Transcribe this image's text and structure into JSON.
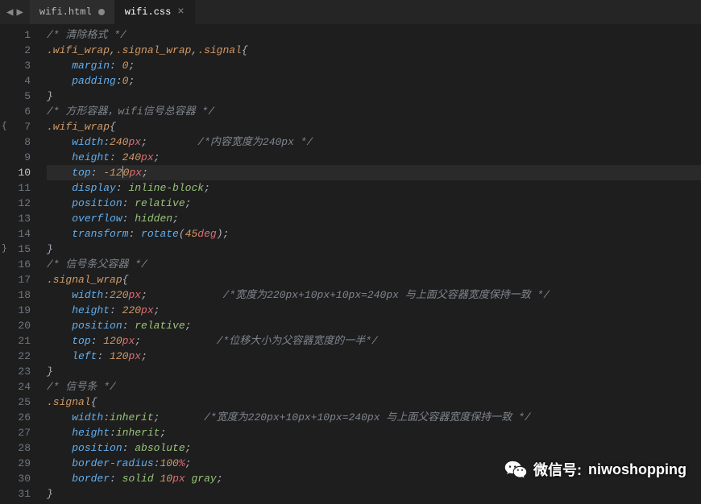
{
  "tabs": [
    {
      "label": "wifi.html",
      "modified": true,
      "active": false
    },
    {
      "label": "wifi.css",
      "modified": false,
      "active": true
    }
  ],
  "active_line": 10,
  "fold_open_line": 7,
  "fold_close_line": 15,
  "code_lines": [
    {
      "n": 1,
      "tokens": [
        {
          "t": "/* 清除格式 */",
          "c": "c-comment"
        }
      ]
    },
    {
      "n": 2,
      "tokens": [
        {
          "t": ".wifi_wrap",
          "c": "c-sel"
        },
        {
          "t": ",",
          "c": "c-punc"
        },
        {
          "t": ".signal_wrap",
          "c": "c-sel"
        },
        {
          "t": ",",
          "c": "c-punc"
        },
        {
          "t": ".signal",
          "c": "c-sel"
        },
        {
          "t": "{",
          "c": "c-brace"
        }
      ]
    },
    {
      "n": 3,
      "indent": 1,
      "tokens": [
        {
          "t": "margin",
          "c": "c-prop"
        },
        {
          "t": ": ",
          "c": "c-punc"
        },
        {
          "t": "0",
          "c": "c-num"
        },
        {
          "t": ";",
          "c": "c-punc"
        }
      ]
    },
    {
      "n": 4,
      "indent": 1,
      "tokens": [
        {
          "t": "padding",
          "c": "c-prop"
        },
        {
          "t": ":",
          "c": "c-punc"
        },
        {
          "t": "0",
          "c": "c-num"
        },
        {
          "t": ";",
          "c": "c-punc"
        }
      ]
    },
    {
      "n": 5,
      "tokens": [
        {
          "t": "}",
          "c": "c-brace"
        }
      ]
    },
    {
      "n": 6,
      "tokens": [
        {
          "t": "/* 方形容器，wifi信号总容器 */",
          "c": "c-comment"
        }
      ]
    },
    {
      "n": 7,
      "tokens": [
        {
          "t": ".wifi_wrap",
          "c": "c-sel"
        },
        {
          "t": "{",
          "c": "c-brace"
        }
      ]
    },
    {
      "n": 8,
      "indent": 1,
      "tokens": [
        {
          "t": "width",
          "c": "c-prop"
        },
        {
          "t": ":",
          "c": "c-punc"
        },
        {
          "t": "240",
          "c": "c-num"
        },
        {
          "t": "px",
          "c": "c-unit"
        },
        {
          "t": ";",
          "c": "c-punc"
        },
        {
          "t": "        ",
          "c": ""
        },
        {
          "t": "/*内容宽度为240px */",
          "c": "c-comment"
        }
      ]
    },
    {
      "n": 9,
      "indent": 1,
      "tokens": [
        {
          "t": "height",
          "c": "c-prop"
        },
        {
          "t": ": ",
          "c": "c-punc"
        },
        {
          "t": "240",
          "c": "c-num"
        },
        {
          "t": "px",
          "c": "c-unit"
        },
        {
          "t": ";",
          "c": "c-punc"
        }
      ]
    },
    {
      "n": 10,
      "indent": 1,
      "cursor_after": 2,
      "tokens": [
        {
          "t": "top",
          "c": "c-prop"
        },
        {
          "t": ": ",
          "c": "c-punc"
        },
        {
          "t": "-12",
          "c": "c-num"
        },
        {
          "t": "|CURSOR|",
          "c": ""
        },
        {
          "t": "0",
          "c": "c-num"
        },
        {
          "t": "px",
          "c": "c-unit"
        },
        {
          "t": ";",
          "c": "c-punc"
        }
      ]
    },
    {
      "n": 11,
      "indent": 1,
      "tokens": [
        {
          "t": "display",
          "c": "c-prop"
        },
        {
          "t": ": ",
          "c": "c-punc"
        },
        {
          "t": "inline-block",
          "c": "c-val"
        },
        {
          "t": ";",
          "c": "c-punc"
        }
      ]
    },
    {
      "n": 12,
      "indent": 1,
      "tokens": [
        {
          "t": "position",
          "c": "c-prop"
        },
        {
          "t": ": ",
          "c": "c-punc"
        },
        {
          "t": "relative",
          "c": "c-val"
        },
        {
          "t": ";",
          "c": "c-punc"
        }
      ]
    },
    {
      "n": 13,
      "indent": 1,
      "tokens": [
        {
          "t": "overflow",
          "c": "c-prop"
        },
        {
          "t": ": ",
          "c": "c-punc"
        },
        {
          "t": "hidden",
          "c": "c-val"
        },
        {
          "t": ";",
          "c": "c-punc"
        }
      ]
    },
    {
      "n": 14,
      "indent": 1,
      "tokens": [
        {
          "t": "transform",
          "c": "c-prop"
        },
        {
          "t": ": ",
          "c": "c-punc"
        },
        {
          "t": "rotate",
          "c": "c-func"
        },
        {
          "t": "(",
          "c": "c-punc"
        },
        {
          "t": "45",
          "c": "c-num"
        },
        {
          "t": "deg",
          "c": "c-unit"
        },
        {
          "t": ")",
          "c": "c-punc"
        },
        {
          "t": ";",
          "c": "c-punc"
        }
      ]
    },
    {
      "n": 15,
      "tokens": [
        {
          "t": "}",
          "c": "c-brace"
        }
      ]
    },
    {
      "n": 16,
      "tokens": [
        {
          "t": "/* 信号条父容器 */",
          "c": "c-comment"
        }
      ]
    },
    {
      "n": 17,
      "tokens": [
        {
          "t": ".signal_wrap",
          "c": "c-sel"
        },
        {
          "t": "{",
          "c": "c-brace"
        }
      ]
    },
    {
      "n": 18,
      "indent": 1,
      "tokens": [
        {
          "t": "width",
          "c": "c-prop"
        },
        {
          "t": ":",
          "c": "c-punc"
        },
        {
          "t": "220",
          "c": "c-num"
        },
        {
          "t": "px",
          "c": "c-unit"
        },
        {
          "t": ";",
          "c": "c-punc"
        },
        {
          "t": "            ",
          "c": ""
        },
        {
          "t": "/*宽度为220px+10px+10px=240px 与上面父容器宽度保持一致 */",
          "c": "c-comment"
        }
      ]
    },
    {
      "n": 19,
      "indent": 1,
      "tokens": [
        {
          "t": "height",
          "c": "c-prop"
        },
        {
          "t": ": ",
          "c": "c-punc"
        },
        {
          "t": "220",
          "c": "c-num"
        },
        {
          "t": "px",
          "c": "c-unit"
        },
        {
          "t": ";",
          "c": "c-punc"
        }
      ]
    },
    {
      "n": 20,
      "indent": 1,
      "tokens": [
        {
          "t": "position",
          "c": "c-prop"
        },
        {
          "t": ": ",
          "c": "c-punc"
        },
        {
          "t": "relative",
          "c": "c-val"
        },
        {
          "t": ";",
          "c": "c-punc"
        }
      ]
    },
    {
      "n": 21,
      "indent": 1,
      "tokens": [
        {
          "t": "top",
          "c": "c-prop"
        },
        {
          "t": ": ",
          "c": "c-punc"
        },
        {
          "t": "120",
          "c": "c-num"
        },
        {
          "t": "px",
          "c": "c-unit"
        },
        {
          "t": ";",
          "c": "c-punc"
        },
        {
          "t": "            ",
          "c": ""
        },
        {
          "t": "/*位移大小为父容器宽度的一半*/",
          "c": "c-comment"
        }
      ]
    },
    {
      "n": 22,
      "indent": 1,
      "tokens": [
        {
          "t": "left",
          "c": "c-prop"
        },
        {
          "t": ": ",
          "c": "c-punc"
        },
        {
          "t": "120",
          "c": "c-num"
        },
        {
          "t": "px",
          "c": "c-unit"
        },
        {
          "t": ";",
          "c": "c-punc"
        }
      ]
    },
    {
      "n": 23,
      "tokens": [
        {
          "t": "}",
          "c": "c-brace"
        }
      ]
    },
    {
      "n": 24,
      "tokens": [
        {
          "t": "/* 信号条 */",
          "c": "c-comment"
        }
      ]
    },
    {
      "n": 25,
      "tokens": [
        {
          "t": ".signal",
          "c": "c-sel"
        },
        {
          "t": "{",
          "c": "c-brace"
        }
      ]
    },
    {
      "n": 26,
      "indent": 1,
      "tokens": [
        {
          "t": "width",
          "c": "c-prop"
        },
        {
          "t": ":",
          "c": "c-punc"
        },
        {
          "t": "inherit",
          "c": "c-val"
        },
        {
          "t": ";",
          "c": "c-punc"
        },
        {
          "t": "       ",
          "c": ""
        },
        {
          "t": "/*宽度为220px+10px+10px=240px 与上面父容器宽度保持一致 */",
          "c": "c-comment"
        }
      ]
    },
    {
      "n": 27,
      "indent": 1,
      "tokens": [
        {
          "t": "height",
          "c": "c-prop"
        },
        {
          "t": ":",
          "c": "c-punc"
        },
        {
          "t": "inherit",
          "c": "c-val"
        },
        {
          "t": ";",
          "c": "c-punc"
        }
      ]
    },
    {
      "n": 28,
      "indent": 1,
      "tokens": [
        {
          "t": "position",
          "c": "c-prop"
        },
        {
          "t": ": ",
          "c": "c-punc"
        },
        {
          "t": "absolute",
          "c": "c-val"
        },
        {
          "t": ";",
          "c": "c-punc"
        }
      ]
    },
    {
      "n": 29,
      "indent": 1,
      "tokens": [
        {
          "t": "border-radius",
          "c": "c-prop"
        },
        {
          "t": ":",
          "c": "c-punc"
        },
        {
          "t": "100",
          "c": "c-num"
        },
        {
          "t": "%",
          "c": "c-unit"
        },
        {
          "t": ";",
          "c": "c-punc"
        }
      ]
    },
    {
      "n": 30,
      "indent": 1,
      "tokens": [
        {
          "t": "border",
          "c": "c-prop"
        },
        {
          "t": ": ",
          "c": "c-punc"
        },
        {
          "t": "solid",
          "c": "c-val"
        },
        {
          "t": " ",
          "c": ""
        },
        {
          "t": "10",
          "c": "c-num"
        },
        {
          "t": "px",
          "c": "c-unit"
        },
        {
          "t": " ",
          "c": ""
        },
        {
          "t": "gray",
          "c": "c-val"
        },
        {
          "t": ";",
          "c": "c-punc"
        }
      ]
    },
    {
      "n": 31,
      "tokens": [
        {
          "t": "}",
          "c": "c-brace"
        }
      ]
    }
  ],
  "watermark": {
    "prefix": "微信号:",
    "id": "niwoshopping"
  }
}
